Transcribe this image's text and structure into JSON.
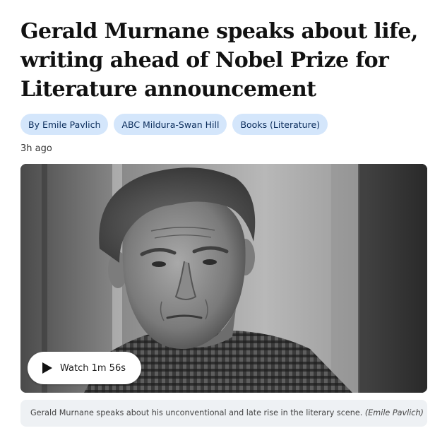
{
  "article": {
    "headline": "Gerald Murnane speaks about life, writing ahead of Nobel Prize for Literature announcement",
    "tags": [
      {
        "label": "By Emile Pavlich"
      },
      {
        "label": "ABC Mildura-Swan Hill"
      },
      {
        "label": "Books (Literature)"
      }
    ],
    "timestamp": "3h ago",
    "tag_color": "#d4e6fb",
    "tag_text_color": "#0b2d5c"
  },
  "media": {
    "image_style": "black-and-white portrait",
    "watch_icon": "play-icon",
    "watch_label": "Watch 1m 56s"
  },
  "caption": {
    "text": "Gerald Murnane speaks about his unconventional and late rise in the literary scene.",
    "credit": "(Emile Pavlich)"
  }
}
